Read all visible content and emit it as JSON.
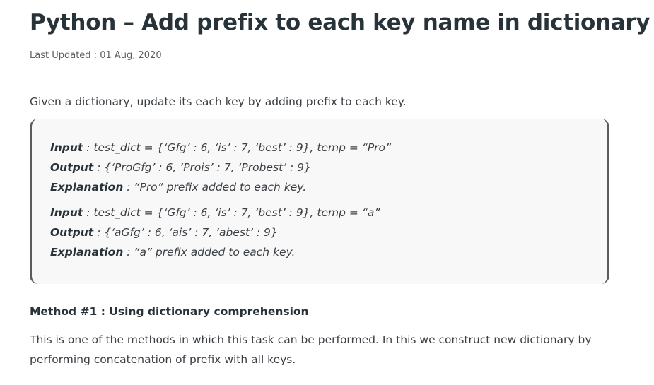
{
  "article": {
    "title": "Python – Add prefix to each key name in dictionary",
    "last_updated": "Last Updated : 01 Aug, 2020",
    "intro": "Given a dictionary, update its each key by adding prefix to each key."
  },
  "examples": [
    {
      "input_label": "Input",
      "input_value": " : test_dict = {‘Gfg’ : 6, ‘is’ : 7, ‘best’ : 9}, temp = “Pro”",
      "output_label": "Output",
      "output_value": " : {‘ProGfg’ : 6, ‘Prois’ : 7, ‘Probest’ : 9}",
      "explanation_label": "Explanation",
      "explanation_value": " : “Pro” prefix added to each key."
    },
    {
      "input_label": "Input",
      "input_value": " : test_dict = {‘Gfg’ : 6, ‘is’ : 7, ‘best’ : 9}, temp = “a”",
      "output_label": "Output",
      "output_value": " : {‘aGfg’ : 6, ‘ais’ : 7, ‘abest’ : 9}",
      "explanation_label": "Explanation",
      "explanation_value": " : “a” prefix added to each key."
    }
  ],
  "method": {
    "heading": "Method #1 : Using dictionary comprehension",
    "description": "This is one of the methods in which this task can be performed. In this we construct new dictionary by performing concatenation of prefix with all keys."
  }
}
